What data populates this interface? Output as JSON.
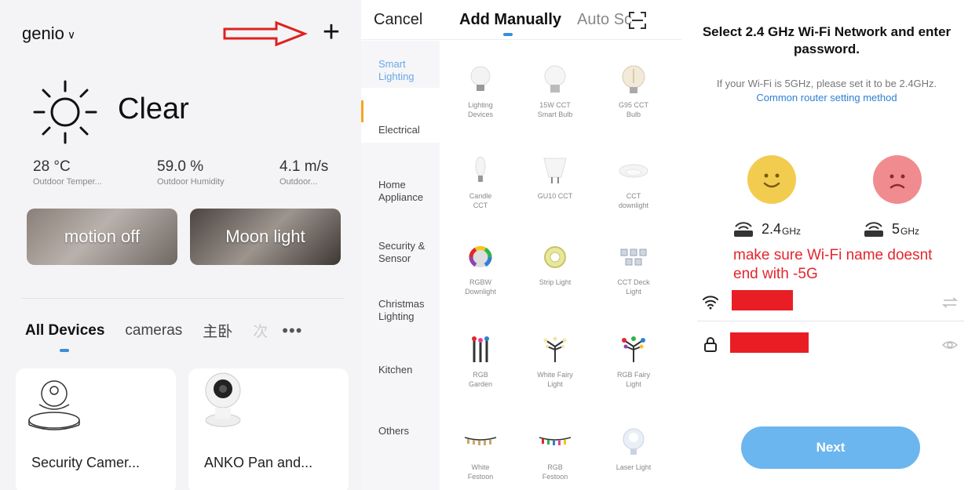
{
  "home": {
    "name": "genio",
    "weather": "Clear",
    "stats": [
      {
        "value": "28 °C",
        "label": "Outdoor Temper..."
      },
      {
        "value": "59.0 %",
        "label": "Outdoor Humidity"
      },
      {
        "value": "4.1 m/s",
        "label": "Outdoor..."
      }
    ],
    "scenes": [
      "motion off",
      "Moon light"
    ],
    "tabs": [
      "All Devices",
      "cameras",
      "主卧",
      "次"
    ],
    "devices": [
      "Security Camer...",
      "ANKO Pan and..."
    ]
  },
  "add": {
    "cancel": "Cancel",
    "manual": "Add Manually",
    "auto": "Auto Sc",
    "categories": [
      "Smart Lighting",
      "Electrical",
      "Home Appliance",
      "Security & Sensor",
      "Christmas Lighting",
      "Kitchen",
      "Others"
    ],
    "items": [
      [
        "Lighting",
        "Devices"
      ],
      [
        "15W CCT",
        "Smart Bulb"
      ],
      [
        "G95 CCT",
        "Bulb"
      ],
      [
        "Candle",
        "CCT"
      ],
      [
        "GU10 CCT",
        ""
      ],
      [
        "CCT",
        "downlight"
      ],
      [
        "RGBW",
        "Downlight"
      ],
      [
        "Strip Light",
        ""
      ],
      [
        "CCT Deck",
        "Light"
      ],
      [
        "RGB",
        "Garden"
      ],
      [
        "White Fairy",
        "Light"
      ],
      [
        "RGB Fairy",
        "Light"
      ],
      [
        "White",
        "Festoon"
      ],
      [
        "RGB",
        "Festoon"
      ],
      [
        "Laser Light",
        ""
      ]
    ]
  },
  "wifi": {
    "title": "Select 2.4 GHz Wi-Fi Network and enter password.",
    "note": "If your Wi-Fi is 5GHz, please set it to be 2.4GHz.",
    "link": "Common router setting method",
    "band_good": "2.4",
    "band_good_unit": "GHz",
    "band_bad": "5",
    "band_bad_unit": "GHz",
    "warning": "make sure Wi-Fi name doesnt end with -5G",
    "next": "Next"
  },
  "colors": {
    "accent": "#3b8fd9",
    "next_button": "#6bb6ef",
    "warning": "#e3262d",
    "redaction": "#e91e25"
  }
}
